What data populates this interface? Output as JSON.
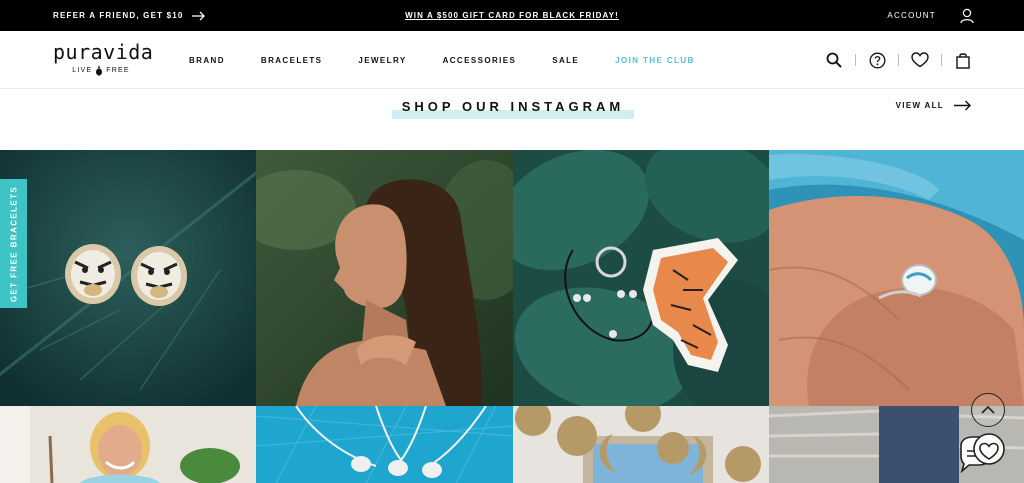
{
  "promo": {
    "refer_label": "REFER A FRIEND, GET $10",
    "center_label": "WIN A $500 GIFT CARD FOR BLACK FRIDAY!",
    "account_label": "ACCOUNT"
  },
  "header": {
    "logo_word": "puravida",
    "logo_tag_left": "LIVE",
    "logo_tag_right": "FREE",
    "nav": [
      {
        "label": "BRAND"
      },
      {
        "label": "BRACELETS"
      },
      {
        "label": "JEWELRY"
      },
      {
        "label": "ACCESSORIES"
      },
      {
        "label": "SALE"
      },
      {
        "label": "JOIN THE CLUB"
      }
    ],
    "icons": [
      "search-icon",
      "help-icon",
      "heart-icon",
      "bag-icon"
    ]
  },
  "instagram": {
    "title": "SHOP OUR INSTAGRAM",
    "view_all": "VIEW ALL"
  },
  "side_tab": {
    "label": "GET FREE BRACELETS"
  },
  "colors": {
    "accent": "#4ec3cf",
    "side_tab": "#3ec4c4",
    "highlight": "#cfeff1",
    "promo_bg": "#000000"
  }
}
